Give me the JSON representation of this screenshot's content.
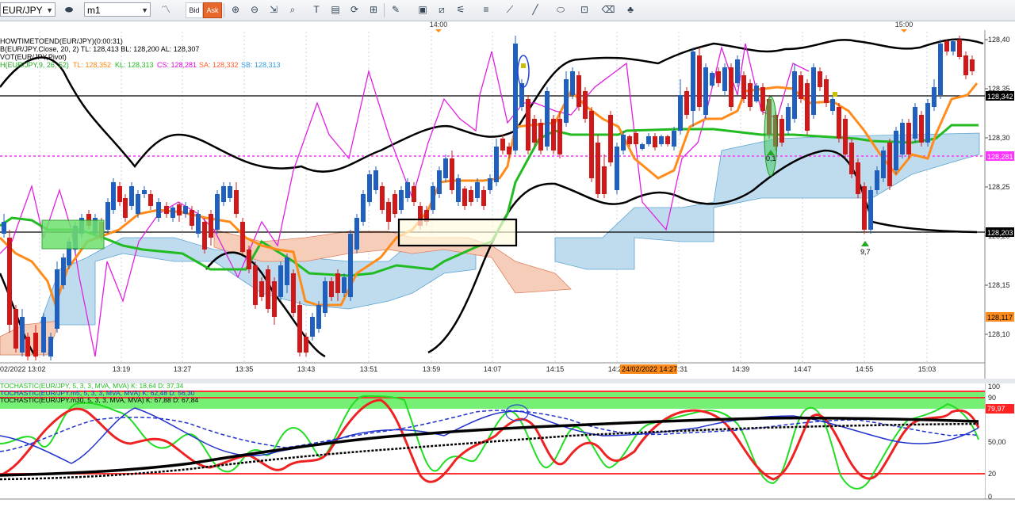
{
  "toolbar": {
    "symbol": "EUR/JPY",
    "timeframe": "m1",
    "bid_label": "Bid",
    "ask_label": "Ask",
    "tools": [
      "candle-type-icon",
      "zoom-in-icon",
      "zoom-out-icon",
      "chart-scale-icon",
      "fit-icon",
      "text-icon",
      "template-icon",
      "refresh-icon",
      "indicators-icon",
      "pencil-icon",
      "image-icon",
      "trendlines-icon",
      "lines-icon",
      "fibonacci-icon",
      "pen-icon",
      "shape-icon",
      "objects-icon",
      "eraser-icon",
      "tree-icon"
    ]
  },
  "main_chart": {
    "legend": [
      {
        "text": "HOWTIMETOEND(EUR/JPY)(0:00:31)",
        "color": "#000000"
      },
      {
        "text": "B(EUR/JPY.Close, 20, 2)  TL: 128,413  BL: 128,200  AL: 128,307",
        "color": "#000000"
      },
      {
        "text": "VOT(EUR/JPY,Pivot)",
        "color": "#000000"
      }
    ],
    "ichimoku_legend": {
      "name": "H(EUR/JPY,9, 26, 52)",
      "items": [
        {
          "text": "TL: 128,352",
          "color": "#ff7f0e"
        },
        {
          "text": "KL: 128,313",
          "color": "#22bb22"
        },
        {
          "text": "CS: 128,281",
          "color": "#dd00dd"
        },
        {
          "text": "SA: 128,332",
          "color": "#ff5a2a"
        },
        {
          "text": "SB: 128,313",
          "color": "#3399dd"
        }
      ]
    },
    "top_time_labels": [
      "14:00",
      "15:00"
    ],
    "price_axis_ticks": [
      "128,40",
      "128,35",
      "128,30",
      "128,25",
      "128,20",
      "128,15",
      "128,10"
    ],
    "price_axis_tags": [
      {
        "text": "128,342",
        "bg": "#000000",
        "fg": "#ffffff"
      },
      {
        "text": "128,281",
        "bg": "#ff33ff",
        "fg": "#ffffff"
      },
      {
        "text": "128,203",
        "bg": "#000000",
        "fg": "#ffffff"
      },
      {
        "text": "128,117",
        "bg": "#ff8c1a",
        "fg": "#000000"
      }
    ],
    "time_axis_labels": [
      "02/2022 13:02",
      "13:19",
      "13:27",
      "13:35",
      "13:43",
      "13:51",
      "13:59",
      "14:07",
      "14:15",
      "14:23",
      "14:31",
      "14:39",
      "14:47",
      "14:55",
      "15:03"
    ],
    "crosshair_time_label": "24/02/2022 14:27",
    "fractal_labels": [
      "0,1",
      "9,7"
    ]
  },
  "oscillator": {
    "legend": [
      {
        "text": "TOCHASTIC(EUR/JPY, 5, 3, 3, MVA, MVA)  K: 18,64  D: 37,34",
        "color": "#22bb22"
      },
      {
        "text": "TOCHASTIC(EUR/JPY.m5, 5, 3, 3, MVA, MVA)  K: 62,48  D: 56,30",
        "color": "#2233cc"
      },
      {
        "text": "TOCHASTIC(EUR/JPY.m30, 5, 3, 3, MVA, MVA)  K: 67,88  D: 67,84",
        "color": "#000000"
      }
    ],
    "axis_ticks": [
      "100",
      "90",
      "50,00",
      "20",
      "0"
    ],
    "value_tag": {
      "text": "79,97",
      "bg": "#ff2222",
      "fg": "#ffffff"
    }
  }
}
